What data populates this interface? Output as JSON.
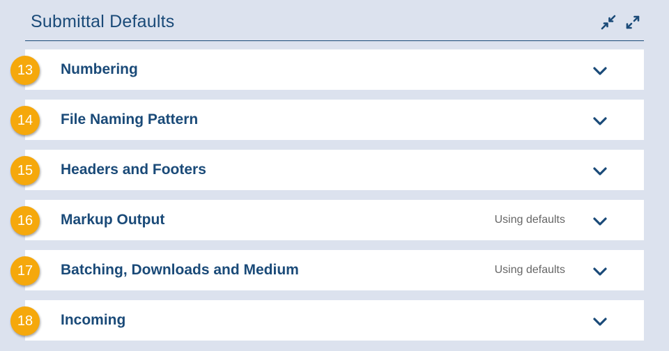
{
  "header": {
    "title": "Submittal Defaults",
    "collapse_icon": "collapse-arrows-icon",
    "expand_icon": "expand-arrows-icon"
  },
  "sections": [
    {
      "badge": "13",
      "label": "Numbering",
      "status": ""
    },
    {
      "badge": "14",
      "label": "File Naming Pattern",
      "status": ""
    },
    {
      "badge": "15",
      "label": "Headers and Footers",
      "status": ""
    },
    {
      "badge": "16",
      "label": "Markup Output",
      "status": "Using defaults"
    },
    {
      "badge": "17",
      "label": "Batching, Downloads and Medium",
      "status": "Using defaults"
    },
    {
      "badge": "18",
      "label": "Incoming",
      "status": ""
    }
  ],
  "colors": {
    "background": "#dce2ee",
    "primary": "#1a4a78",
    "badge": "#f5a80c",
    "panel": "#ffffff",
    "status_text": "#666666"
  }
}
